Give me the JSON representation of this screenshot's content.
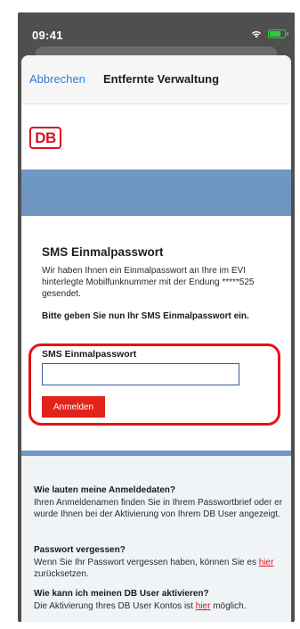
{
  "status_bar": {
    "time": "09:41",
    "icons": [
      "wifi-icon",
      "battery-icon"
    ],
    "battery_color": "#2ecc40"
  },
  "nav": {
    "cancel_label": "Abbrechen",
    "title": "Entfernte Verwaltung",
    "accent": "#2f7fd6"
  },
  "brand": {
    "logo_text": "DB",
    "logo_color": "#d6131e",
    "banner_color": "#6f98c4"
  },
  "form": {
    "heading": "SMS Einmalpasswort",
    "intro": "Wir haben Ihnen ein Einmalpasswort an Ihre im EVI hinterlegte Mobilfunknummer mit der Endung *****525 gesendet.",
    "instruction": "Bitte geben Sie nun Ihr SMS Einmalpasswort ein.",
    "field_label": "SMS Einmalpasswort",
    "field_value": "",
    "submit_label": "Anmelden",
    "submit_color": "#e2231a"
  },
  "faq": [
    {
      "question": "Wie lauten meine Anmeldedaten?",
      "answer": "Ihren Anmeldenamen finden Sie in Ihrem Passwortbrief oder er wurde Ihnen bei der Aktivierung von Ihrem DB User angezeigt."
    },
    {
      "question": "Passwort vergessen?",
      "answer_before": "Wenn Sie Ihr Passwort vergessen haben, können Sie es ",
      "link": "hier",
      "answer_after": " zurücksetzen."
    },
    {
      "question": "Wie kann ich meinen DB User aktivieren?",
      "answer_before": "Die Aktivierung Ihres DB User Kontos ist ",
      "link": "hier",
      "answer_after": " möglich."
    }
  ]
}
